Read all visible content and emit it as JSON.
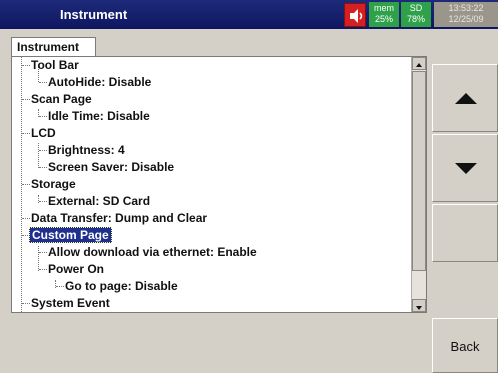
{
  "window": {
    "title": "Instrument"
  },
  "status": {
    "speaker_icon": "speaker-icon",
    "mem_label": "mem",
    "mem_value": "25%",
    "sd_label": "SD",
    "sd_value": "78%",
    "time": "13:53:22",
    "date": "12/25/09"
  },
  "tab": {
    "label": "Instrument"
  },
  "tree": {
    "items": [
      "Tool Bar",
      "AutoHide: Disable",
      "Scan Page",
      "Idle Time: Disable",
      "LCD",
      "Brightness: 4",
      "Screen Saver: Disable",
      "Storage",
      "External: SD Card",
      "Data Transfer: Dump and Clear",
      "Custom Page",
      "Allow download via ethernet: Enable",
      "Power On",
      "Go to page: Disable",
      "System Event"
    ],
    "selected": "Custom Page"
  },
  "buttons": {
    "up_icon": "arrow-up-icon",
    "down_icon": "arrow-down-icon",
    "back": "Back"
  },
  "colors": {
    "titlebar": "#1e2b7a",
    "status_green": "#2ea14a",
    "selection": "#1e2f8e",
    "speaker_red": "#d42020"
  }
}
